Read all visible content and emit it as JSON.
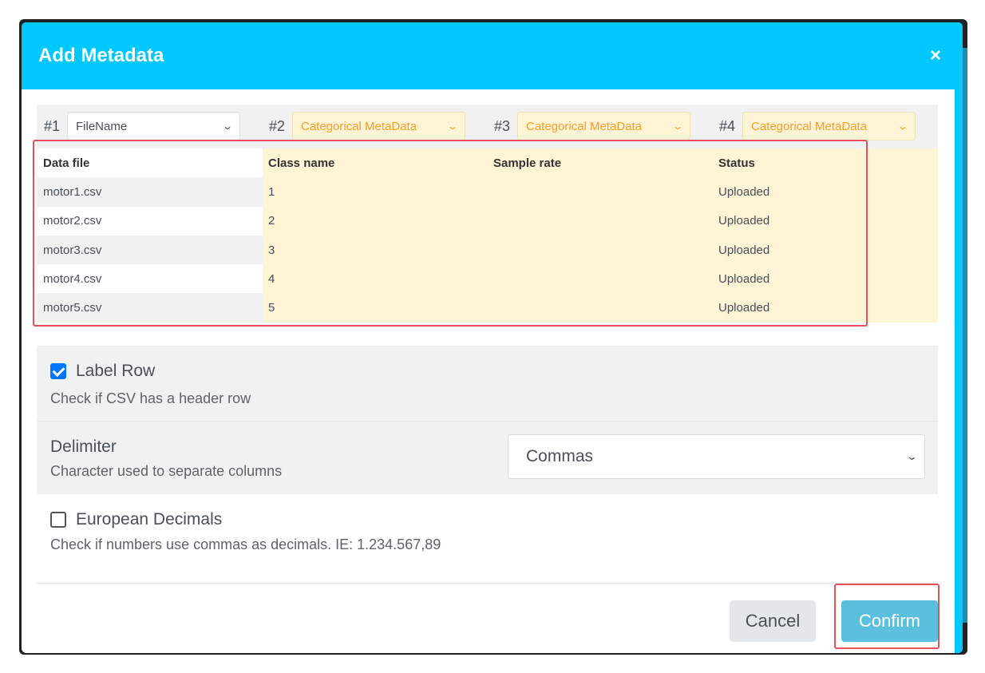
{
  "dialog": {
    "title": "Add Metadata",
    "close_label": "×"
  },
  "selectors": [
    {
      "num": "#1",
      "value": "FileName"
    },
    {
      "num": "#2",
      "value": "Categorical MetaData"
    },
    {
      "num": "#3",
      "value": "Categorical MetaData"
    },
    {
      "num": "#4",
      "value": "Categorical MetaData"
    }
  ],
  "table": {
    "headers": [
      "Data file",
      "Class name",
      "Sample rate",
      "Status"
    ],
    "rows": [
      [
        "motor1.csv",
        "1",
        "",
        "Uploaded"
      ],
      [
        "motor2.csv",
        "2",
        "",
        "Uploaded"
      ],
      [
        "motor3.csv",
        "3",
        "",
        "Uploaded"
      ],
      [
        "motor4.csv",
        "4",
        "",
        "Uploaded"
      ],
      [
        "motor5.csv",
        "5",
        "",
        "Uploaded"
      ]
    ]
  },
  "options": {
    "label_row": {
      "title": "Label Row",
      "description": "Check if CSV has a header row",
      "checked": true
    },
    "delimiter": {
      "title": "Delimiter",
      "description": "Character used to separate columns",
      "value": "Commas"
    },
    "european_decimals": {
      "title": "European Decimals",
      "description": "Check if numbers use commas as decimals. IE: 1.234.567,89",
      "checked": false
    }
  },
  "footer": {
    "cancel_label": "Cancel",
    "confirm_label": "Confirm"
  },
  "colors": {
    "header_bg": "#00c8ff",
    "categorical_bg": "#fff5d6",
    "categorical_text": "#ff9c24",
    "confirm_bg": "#5bc0de",
    "highlight": "#e8505b"
  },
  "icons": {
    "select_chevron": "chevron-down-icon",
    "close": "close-icon",
    "checkbox_checked": "checkmark-icon"
  }
}
